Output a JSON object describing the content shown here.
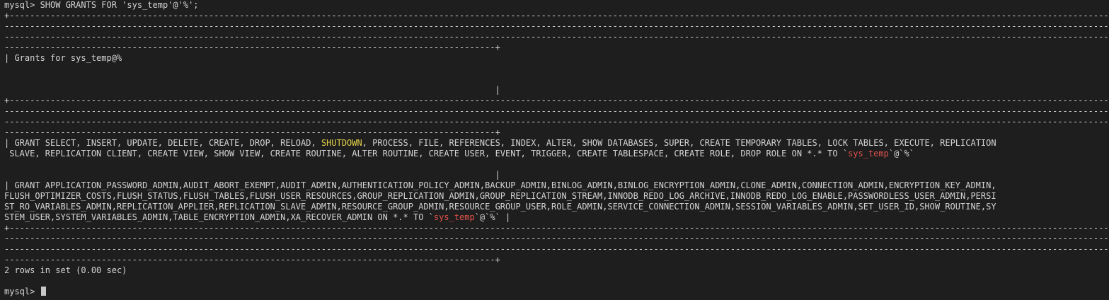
{
  "command_line": "mysql> SHOW GRANTS FOR 'sys_temp'@'%';",
  "border_full": "+--------------------------------------------------------------------------------------------------------------------------------------------------------------------------------------------------------------------------------------------------------------------------------------",
  "border_dashes": "---------------------------------------------------------------------------------------------------------------------------------------------------------------------------------------------------------------------------------------------------------------------------------------",
  "border_end": "------------------------------------------------------------------------------------------------+",
  "header_text": "| Grants for sys_temp@%",
  "pipe_mid": "                                                                                                |",
  "row1": {
    "l1_a": "| GRANT SELECT, INSERT, UPDATE, DELETE, CREATE, DROP, RELOAD, ",
    "l1_hl": "SHUTDOWN",
    "l1_b": ", PROCESS, FILE, REFERENCES, INDEX, ALTER, SHOW DATABASES, SUPER, CREATE TEMPORARY TABLES, LOCK TABLES, EXECUTE, REPLICATION",
    "l2_a": " SLAVE, REPLICATION CLIENT, CREATE VIEW, SHOW VIEW, CREATE ROUTINE, ALTER ROUTINE, CREATE USER, EVENT, TRIGGER, CREATE TABLESPACE, CREATE ROLE, DROP ROLE ON *.* TO `",
    "l2_hl": "sys_temp",
    "l2_b": "`@`%`"
  },
  "row2": {
    "l1": "| GRANT APPLICATION_PASSWORD_ADMIN,AUDIT_ABORT_EXEMPT,AUDIT_ADMIN,AUTHENTICATION_POLICY_ADMIN,BACKUP_ADMIN,BINLOG_ADMIN,BINLOG_ENCRYPTION_ADMIN,CLONE_ADMIN,CONNECTION_ADMIN,ENCRYPTION_KEY_ADMIN,",
    "l2": "FLUSH_OPTIMIZER_COSTS,FLUSH_STATUS,FLUSH_TABLES,FLUSH_USER_RESOURCES,GROUP_REPLICATION_ADMIN,GROUP_REPLICATION_STREAM,INNODB_REDO_LOG_ARCHIVE,INNODB_REDO_LOG_ENABLE,PASSWORDLESS_USER_ADMIN,PERSI",
    "l3": "ST_RO_VARIABLES_ADMIN,REPLICATION_APPLIER,REPLICATION_SLAVE_ADMIN,RESOURCE_GROUP_ADMIN,RESOURCE_GROUP_USER,ROLE_ADMIN,SERVICE_CONNECTION_ADMIN,SESSION_VARIABLES_ADMIN,SET_USER_ID,SHOW_ROUTINE,SY",
    "l4_a": "STEM_USER,SYSTEM_VARIABLES_ADMIN,TABLE_ENCRYPTION_ADMIN,XA_RECOVER_ADMIN ON *.* TO `",
    "l4_hl": "sys_temp",
    "l4_b": "`@`%` |"
  },
  "result_summary": "2 rows in set (0.00 sec)",
  "prompt": "mysql> ",
  "colors": {
    "background": "#1e1e1e",
    "text": "#d4d4d4",
    "highlight_yellow": "#e5d34a",
    "highlight_red": "#e0504a"
  }
}
